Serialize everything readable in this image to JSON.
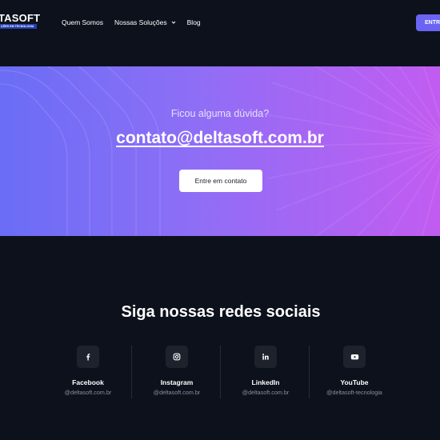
{
  "header": {
    "logo_word": "TASOFT",
    "logo_tagline": "ÇÕES EM TECNOLOGIA",
    "nav": [
      {
        "label": "Quem Somos",
        "has_dropdown": false
      },
      {
        "label": "Nossas Soluções",
        "has_dropdown": true,
        "icon": "chevron-down-icon"
      },
      {
        "label": "Blog",
        "has_dropdown": false
      }
    ],
    "cta_label": "ENTR"
  },
  "hero": {
    "question": "Ficou alguma dúvida?",
    "email": "contato@deltasoft.com.br",
    "button_label": "Entre em contato"
  },
  "social": {
    "title": "Siga nossas redes sociais",
    "items": [
      {
        "name": "Facebook",
        "handle": "@deltasoft.com.br",
        "icon": "facebook-icon"
      },
      {
        "name": "Instagram",
        "handle": "@deltasoft.com.br",
        "icon": "instagram-icon"
      },
      {
        "name": "LinkedIn",
        "handle": "@deltasoft.com.br",
        "icon": "linkedin-icon"
      },
      {
        "name": "YouTube",
        "handle": "@deltasoft-tecnologia",
        "icon": "youtube-icon"
      }
    ]
  },
  "colors": {
    "background": "#0d111c",
    "accent": "#6b63f2",
    "hero_gradient_start": "#6a6df6",
    "hero_gradient_end": "#c25cf1",
    "icon_box": "#1e222d",
    "handle_text": "#8a90a0"
  }
}
